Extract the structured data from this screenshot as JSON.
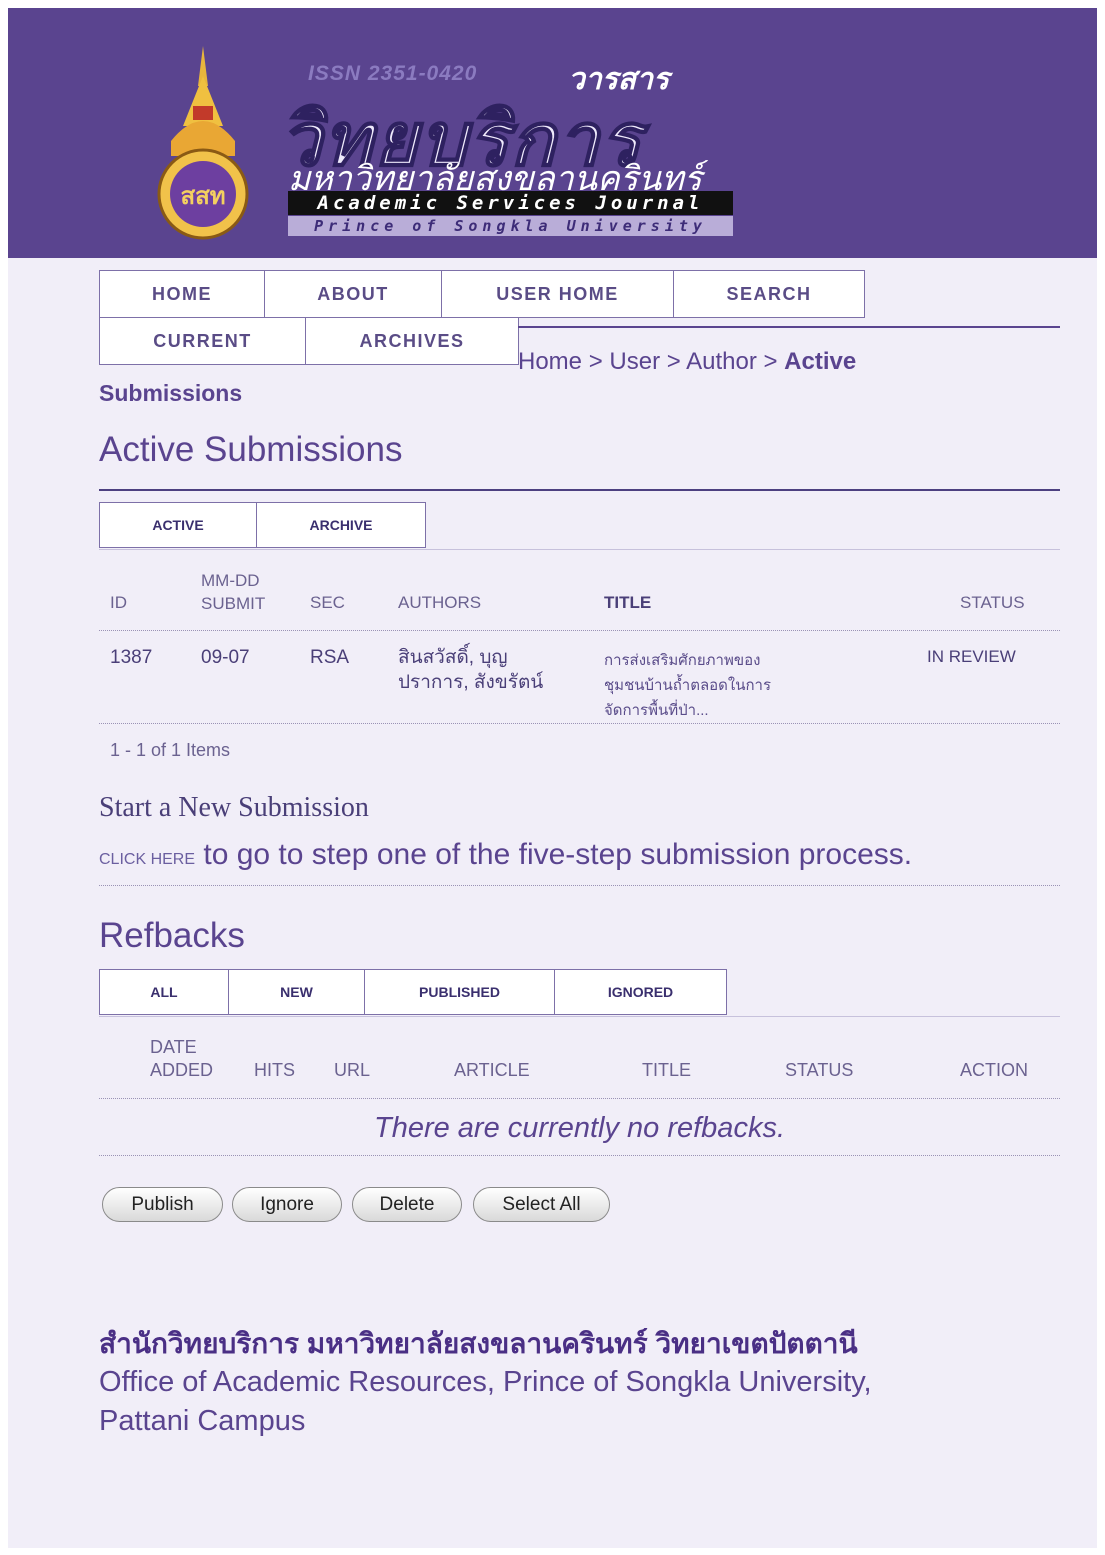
{
  "header": {
    "issn": "ISSN 2351-0420",
    "journal_thai_small": "วารสาร",
    "journal_thai_big": "วิทยบริการ",
    "university_thai": "มหาวิทยาลัยสงขลานครินทร์",
    "journal_en": "Academic Services Journal",
    "university_en": "Prince of Songkla University",
    "logo_text": "สสท"
  },
  "nav": {
    "row1": [
      "HOME",
      "ABOUT",
      "USER HOME",
      "SEARCH"
    ],
    "row2": [
      "CURRENT",
      "ARCHIVES"
    ]
  },
  "breadcrumb": {
    "home": "Home",
    "sep": ">",
    "user": "User",
    "author": "Author",
    "current_part1": "Active",
    "current_part2": "Submissions"
  },
  "active": {
    "title": "Active Submissions",
    "tabs": [
      "ACTIVE",
      "ARCHIVE"
    ],
    "columns": {
      "id": "ID",
      "date_line1": "MM-DD",
      "date_line2": "SUBMIT",
      "sec": "SEC",
      "authors": "AUTHORS",
      "title": "TITLE",
      "status": "STATUS"
    },
    "rows": [
      {
        "id": "1387",
        "date": "09-07",
        "sec": "RSA",
        "authors_line1": "สินสวัสดิ์, บุญ",
        "authors_line2": "ปราการ, สังขรัตน์",
        "title_line1": "การส่งเสริมศักยภาพของ",
        "title_line2": "ชุมชนบ้านถ้ำตลอดในการ",
        "title_line3": "จัดการพื้นที่ป่า...",
        "status": "IN REVIEW"
      }
    ],
    "pagination": "1 - 1 of 1 Items"
  },
  "new_submission": {
    "title": "Start a New Submission",
    "link": "CLICK HERE",
    "text": "to go to step one of the five-step submission process."
  },
  "refbacks": {
    "title": "Refbacks",
    "tabs": [
      "ALL",
      "NEW",
      "PUBLISHED",
      "IGNORED"
    ],
    "columns": {
      "date_line1": "DATE",
      "date_line2": "ADDED",
      "hits": "HITS",
      "url": "URL",
      "article": "ARTICLE",
      "title": "TITLE",
      "status": "STATUS",
      "action": "ACTION"
    },
    "empty": "There are currently no refbacks.",
    "buttons": [
      "Publish",
      "Ignore",
      "Delete",
      "Select All"
    ]
  },
  "footer": {
    "thai": "สำนักวิทยบริการ มหาวิทยาลัยสงขลานครินทร์ วิทยาเขตปัตตานี",
    "en_line1": "Office of Academic Resources, Prince of Songkla University,",
    "en_line2": "Pattani Campus"
  },
  "colors": {
    "header_bg": "#5a448f",
    "page_bg": "#f1eef8",
    "accent": "#5a448f"
  }
}
